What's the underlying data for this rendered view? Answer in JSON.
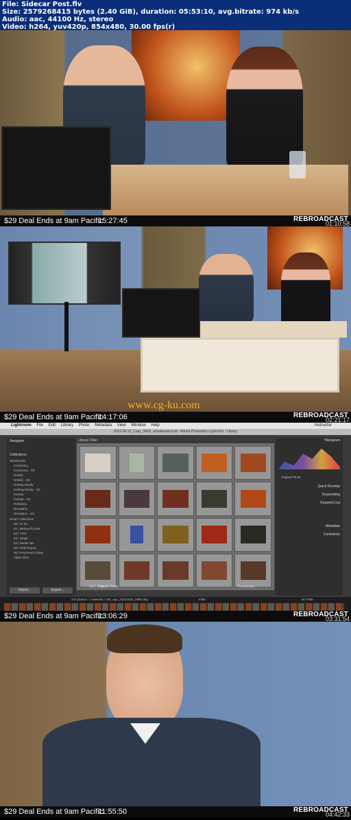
{
  "header": {
    "file": "File: Sidecar Post.flv",
    "size": "Size: 2579268415 bytes (2.40 GiB), duration: 05:53:10, avg.bitrate: 974 kb/s",
    "audio": "Audio: aac, 44100 Hz, stereo",
    "video": "Video: h264, yuv420p, 854x480, 30.00 fps(r)"
  },
  "frames": [
    {
      "deal": "$29 Deal Ends at 9am Pacific",
      "clock": "15:27:45",
      "brand": "REBROADCAST",
      "timecode": "01:10:58"
    },
    {
      "deal": "$29 Deal Ends at 9am Pacific",
      "clock": "14:17:06",
      "brand": "REBROADCAST",
      "timecode": "02:21:17",
      "watermark": "www.cg-ku.com"
    },
    {
      "deal": "$29 Deal Ends at 9am Pacific",
      "clock": "13:06:29",
      "brand": "REBROADCAST",
      "timecode": "03:31:54"
    },
    {
      "deal": "$29 Deal Ends at 9am Pacific",
      "clock": "11:55:50",
      "brand": "REBROADCAST",
      "timecode": "04:42:33"
    }
  ],
  "lightroom": {
    "menu": [
      "Lightroom",
      "File",
      "Edit",
      "Library",
      "Photo",
      "Metadata",
      "View",
      "Window",
      "Help"
    ],
    "title": "2013-08-13_Cody_WED_situationals.lrcat - Adobe Photoshop Lightroom - Library",
    "navigator": "Navigator",
    "collections": "Collections",
    "collection_items": [
      "Situationals",
      "Ceremony",
      "Ceremony - SS",
      "Details",
      "Details - SS",
      "Getting Ready",
      "Getting Ready - SS",
      "Portrait",
      "Portrait - SS",
      "Problems",
      "Reception",
      "Reception - SS",
      "Smart Collections",
      "00 | To Do",
      "01 | Marked for BW",
      "02 | TIPS",
      "03 | Jangs",
      "04 | Needs NR",
      "05 | Final Export",
      "06 | Processed Today",
      "Video Files"
    ],
    "library_filter": "Library Filter :",
    "import": "Import...",
    "export": "Export...",
    "sort": "Sort:",
    "sort_value": "Capture Time",
    "thumbnails": "Thumbnails",
    "histogram": "Histogram",
    "original_photo": "Original Photo",
    "quick_develop": "Quick Develop",
    "keywording": "Keywording",
    "keyword_list": "Keyword List",
    "metadata": "Metadata",
    "comments": "Comments",
    "film_status": "216 photos / 1 selected / 345_ego_20101810_0995.dng",
    "filter": "Filter :",
    "no_filter": "No Filter",
    "instructor": "Instructor"
  }
}
